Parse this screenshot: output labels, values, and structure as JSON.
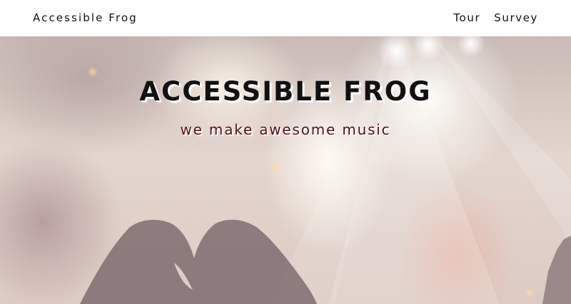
{
  "nav": {
    "brand": "Accessible Frog",
    "links": [
      "Tour",
      "Survey"
    ]
  },
  "hero": {
    "title": "ACCESSIBLE FROG",
    "tagline": "we make awesome music",
    "image": "concert crowd with heart-shaped hands silhouette against stage lights"
  },
  "colors": {
    "nav_bg": "#ffffff",
    "text": "#111111",
    "tagline": "#5a0f18"
  }
}
